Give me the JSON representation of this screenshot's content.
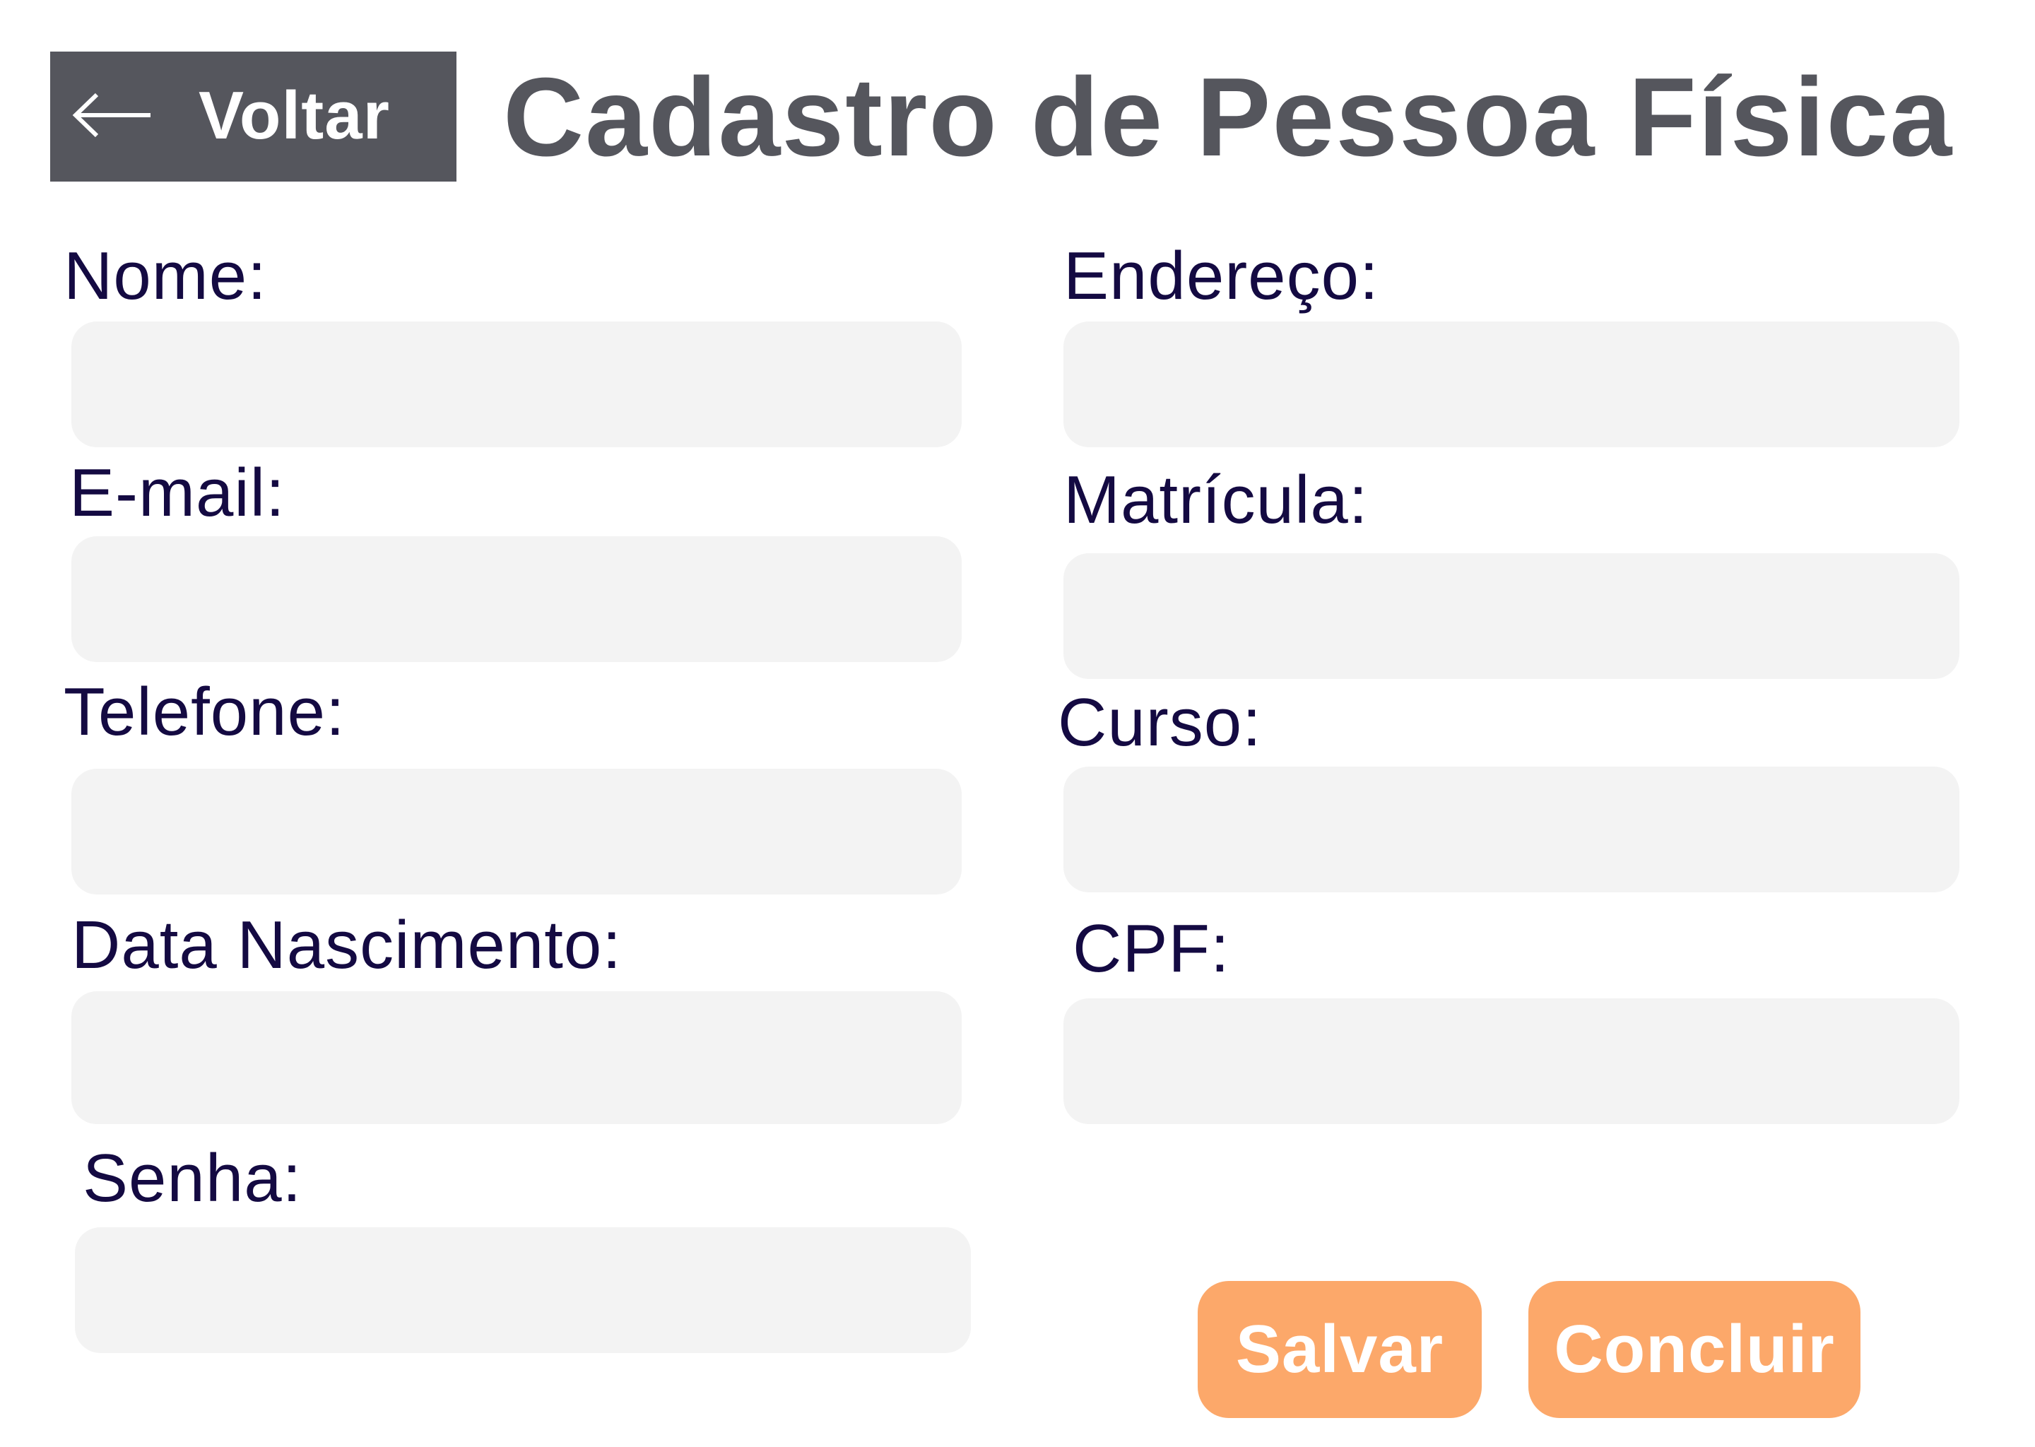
{
  "header": {
    "back_label": "Voltar",
    "back_icon": "arrow-left-icon",
    "title": "Cadastro de Pessoa Física"
  },
  "form": {
    "left": {
      "nome_label": "Nome:",
      "email_label": "E-mail:",
      "telefone_label": "Telefone:",
      "nascimento_label": "Data Nascimento:",
      "senha_label": "Senha:"
    },
    "right": {
      "endereco_label": "Endereço:",
      "matricula_label": "Matrícula:",
      "curso_label": "Curso:",
      "cpf_label": "CPF:"
    },
    "values": {
      "nome": "",
      "email": "",
      "telefone": "",
      "nascimento": "",
      "senha": "",
      "endereco": "",
      "matricula": "",
      "curso": "",
      "cpf": ""
    }
  },
  "actions": {
    "save_label": "Salvar",
    "finish_label": "Concluir"
  },
  "colors": {
    "header_bg": "#55565d",
    "label_text": "#140a42",
    "input_bg": "#f3f3f3",
    "button_bg": "#fca86a"
  }
}
